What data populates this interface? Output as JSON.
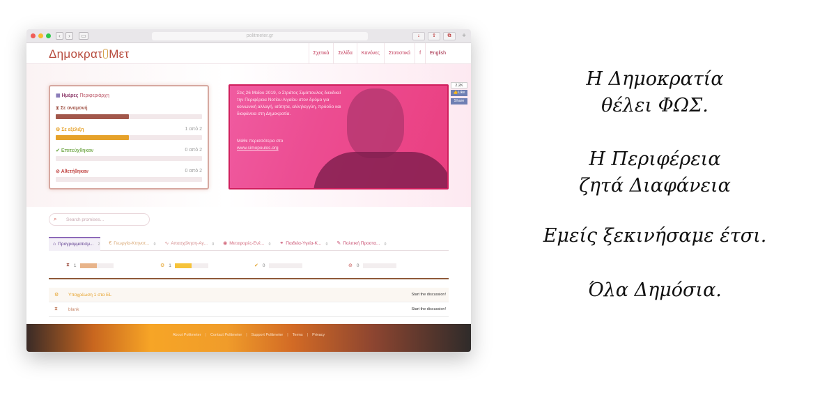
{
  "browser": {
    "url": "politmeter.gr",
    "chrome_buttons": [
      "↓",
      "⇪",
      "⧉"
    ]
  },
  "site": {
    "logo": {
      "left": "Δημοκρατ",
      "right": "Μετ"
    },
    "menu": [
      "Σχετικά",
      "Σελίδα",
      "Κανόνες",
      "Στατιστικά",
      "f",
      "English"
    ]
  },
  "status_card": {
    "title": "Ημέρες",
    "subtitle": "Περιφεριάρχη",
    "rows": [
      {
        "label": "Σε αναμονή",
        "count": "",
        "color": "#a2574b",
        "fill_pct": 50,
        "icon": "hourglass-icon",
        "glyph": "⧗"
      },
      {
        "label": "Σε εξέλιξη",
        "count": "1 από 2",
        "color": "#e6a22a",
        "fill_pct": 50,
        "icon": "cogs-icon",
        "glyph": "⚙"
      },
      {
        "label": "Επιτεύχθηκαν",
        "count": "0 από 2",
        "color": "#7fb05a",
        "fill_pct": 0,
        "icon": "check-icon",
        "glyph": "✔"
      },
      {
        "label": "Αθετήθηκαν",
        "count": "0 από 2",
        "color": "#c34a48",
        "fill_pct": 0,
        "icon": "ban-icon",
        "glyph": "⊘"
      }
    ]
  },
  "hero": {
    "text": "Στις 26 Μαΐου 2019, ο Στράτος Σιμόπουλος διεκδικεί την Περιφέρεια Νοτίου Αιγαίου στον δρόμο για κοινωνική αλλαγή, ισότητα, αλληλεγγύη, πρόοδο και διαφάνεια στη Δημοκρατία.",
    "more_label": "Μάθε περισσότερα στο",
    "more_link": "www.simopoulos.org"
  },
  "social": {
    "count": "2.2K",
    "like": "Like",
    "share": "Share"
  },
  "search": {
    "placeholder": "Search promises..."
  },
  "tabs": [
    {
      "label": "Προγραμματισμ...",
      "badge": "2",
      "active": true,
      "icon": "institution-icon",
      "glyph": "⌂",
      "color": "#5c3a8e"
    },
    {
      "label": "Γεωργία-Κτηνοτ...",
      "badge": "0",
      "active": false,
      "icon": "euro-icon",
      "glyph": "€",
      "color": "#d7a46f"
    },
    {
      "label": "Απασχόληση-Αγ...",
      "badge": "0",
      "active": false,
      "icon": "chart-line-icon",
      "glyph": "∿",
      "color": "#d3898a"
    },
    {
      "label": "Μεταφορές-Ενέ...",
      "badge": "0",
      "active": false,
      "icon": "globe-icon",
      "glyph": "◉",
      "color": "#d36b7e"
    },
    {
      "label": "Παιδεία-Υγεία-Κ...",
      "badge": "0",
      "active": false,
      "icon": "bicycle-icon",
      "glyph": "⚭",
      "color": "#c9506f"
    },
    {
      "label": "Πολιτική Προστα...",
      "badge": "0",
      "active": false,
      "icon": "magic-icon",
      "glyph": "✎",
      "color": "#c74a6d"
    }
  ],
  "stats": [
    {
      "count": "1",
      "icon": "hourglass-icon",
      "glyph": "⧗",
      "color": "#a2574b",
      "fill_pct": 50,
      "fill_color": "#e8b48a"
    },
    {
      "count": "1",
      "icon": "cogs-icon",
      "glyph": "⚙",
      "color": "#e6a22a",
      "fill_pct": 50,
      "fill_color": "#f6c33a"
    },
    {
      "count": "0",
      "icon": "check-icon",
      "glyph": "✔",
      "color": "#e3a532",
      "fill_pct": 0,
      "fill_color": "#f6c33a"
    },
    {
      "count": "0",
      "icon": "ban-icon",
      "glyph": "⊘",
      "color": "#c34a48",
      "fill_pct": 0,
      "fill_color": "#c34a48"
    }
  ],
  "promises": [
    {
      "title": "Υποχρέωση 1 στα EL",
      "action": "Start the discussion!",
      "icon": "cogs-icon",
      "glyph": "⚙",
      "color": "#e6a22a",
      "highlight": true
    },
    {
      "title": "blank",
      "action": "Start the discussion!",
      "icon": "hourglass-icon",
      "glyph": "⧗",
      "color": "#c7896c",
      "highlight": false
    }
  ],
  "footer": [
    "About Politmeter",
    "Contact Politmeter",
    "Support Politmeter",
    "Terms",
    "Privacy"
  ],
  "slogan": [
    [
      "Η Δημοκρατία",
      "θέλει ΦΩΣ."
    ],
    [
      "Η Περιφέρεια",
      "ζητά Διαφάνεια"
    ],
    [
      "Εμείς ξεκινήσαμε έτσι."
    ],
    [
      "Όλα Δημόσια."
    ]
  ]
}
